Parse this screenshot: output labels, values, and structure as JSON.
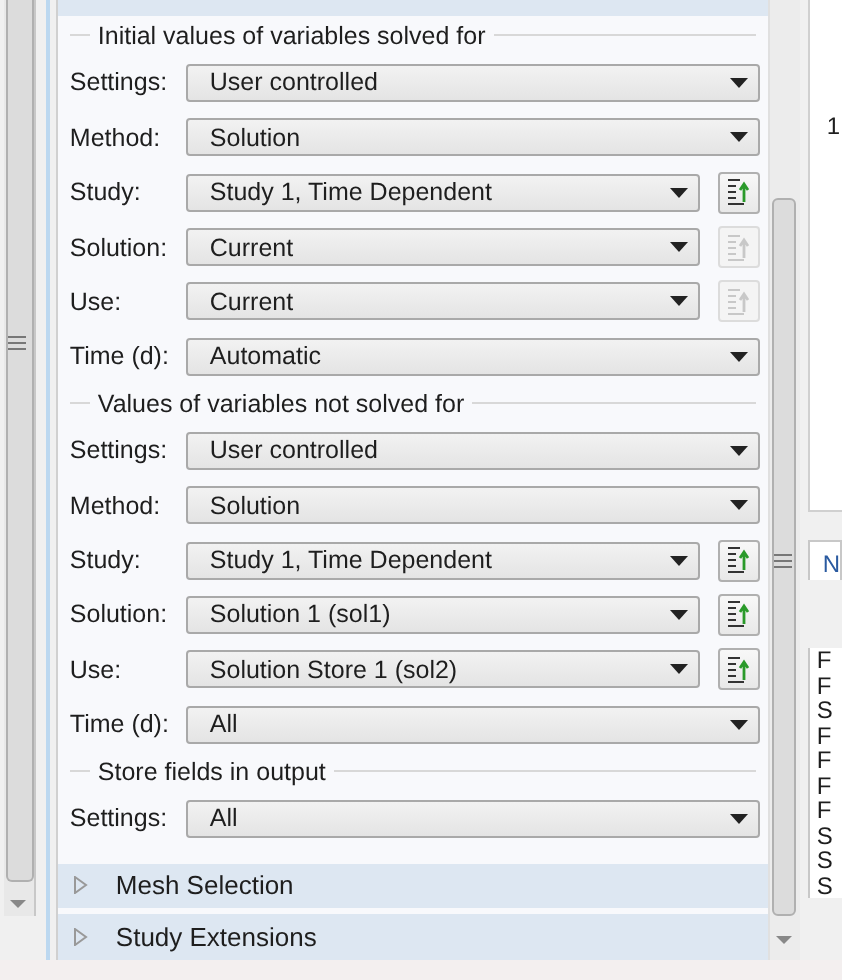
{
  "sections": [
    {
      "title": "Initial values of variables solved for",
      "rows": [
        {
          "label": "Settings:",
          "value": "User controlled"
        },
        {
          "label": "Method:",
          "value": "Solution"
        },
        {
          "label": "Study:",
          "value": "Study 1, Time Dependent",
          "action": {
            "disabled": false
          }
        },
        {
          "label": "Solution:",
          "value": "Current",
          "action": {
            "disabled": true
          }
        },
        {
          "label": "Use:",
          "value": "Current",
          "action": {
            "disabled": true
          }
        },
        {
          "label": "Time (d):",
          "value": "Automatic"
        }
      ]
    },
    {
      "title": "Values of variables not solved for",
      "rows": [
        {
          "label": "Settings:",
          "value": "User controlled"
        },
        {
          "label": "Method:",
          "value": "Solution"
        },
        {
          "label": "Study:",
          "value": "Study 1, Time Dependent",
          "action": {
            "disabled": false
          }
        },
        {
          "label": "Solution:",
          "value": "Solution 1 (sol1)",
          "action": {
            "disabled": false
          }
        },
        {
          "label": "Use:",
          "value": "Solution Store 1 (sol2)",
          "action": {
            "disabled": false
          }
        },
        {
          "label": "Time (d):",
          "value": "All"
        }
      ]
    },
    {
      "title": "Store fields in output",
      "rows": [
        {
          "label": "Settings:",
          "value": "All"
        }
      ]
    }
  ],
  "collapsibles": [
    {
      "title": "Mesh Selection",
      "expanded": false
    },
    {
      "title": "Study Extensions",
      "expanded": false
    }
  ],
  "right_panel": {
    "top_text": "1",
    "tab": "N",
    "items": [
      "F",
      "F",
      "S",
      "F",
      "F",
      "F",
      "F",
      "S",
      "S",
      "S"
    ]
  }
}
